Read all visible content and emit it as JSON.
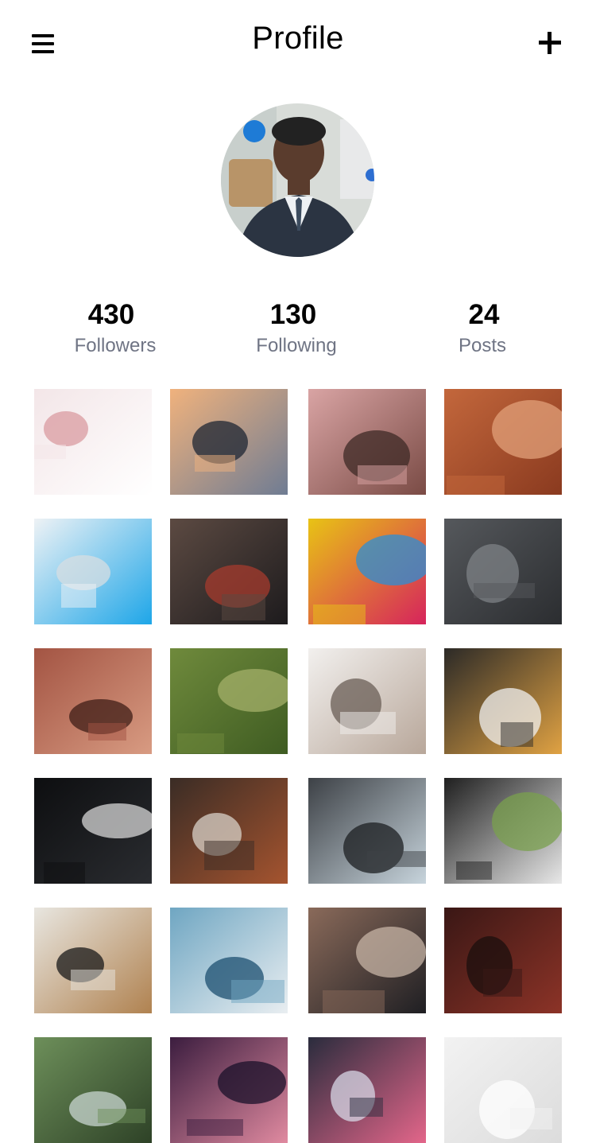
{
  "header": {
    "title": "Profile",
    "menu_icon": "hamburger-menu-icon",
    "add_icon": "plus-icon"
  },
  "profile": {
    "avatar_icon": "profile-avatar",
    "stats": [
      {
        "value": "430",
        "label": "Followers"
      },
      {
        "value": "130",
        "label": "Following"
      },
      {
        "value": "24",
        "label": "Posts"
      }
    ]
  },
  "posts": [
    {
      "name": "post-desk-workspace",
      "colors": [
        "#f3e6e8",
        "#ffffff",
        "#d99ba0"
      ]
    },
    {
      "name": "post-bridge-silhouette",
      "colors": [
        "#f0b27d",
        "#6f7c93",
        "#1e2633"
      ]
    },
    {
      "name": "post-pink-skirt-boots",
      "colors": [
        "#d9a4a4",
        "#7a4b45",
        "#3d2a26"
      ]
    },
    {
      "name": "post-red-hair-braid",
      "colors": [
        "#c3673c",
        "#8a3a1f",
        "#e2a07a"
      ]
    },
    {
      "name": "post-pool-room",
      "colors": [
        "#eef2f5",
        "#1ea6e8",
        "#d7dde2"
      ]
    },
    {
      "name": "post-woman-escalator",
      "colors": [
        "#5c4a42",
        "#1d1b1d",
        "#a63b2e"
      ]
    },
    {
      "name": "post-colorful-balls",
      "colors": [
        "#e8c315",
        "#d6245c",
        "#2b8fd6"
      ]
    },
    {
      "name": "post-black-pebbles",
      "colors": [
        "#55585c",
        "#2b2d30",
        "#7d8186"
      ]
    },
    {
      "name": "post-freckled-face",
      "colors": [
        "#a35443",
        "#d89b82",
        "#3f1e17"
      ]
    },
    {
      "name": "post-bird-on-branch",
      "colors": [
        "#6f8a3c",
        "#3f5c22",
        "#a4b06a"
      ]
    },
    {
      "name": "post-wooden-slats",
      "colors": [
        "#f2f0ee",
        "#b8a79a",
        "#6a5e56"
      ]
    },
    {
      "name": "post-toy-cars-lights",
      "colors": [
        "#2c2a27",
        "#e0a243",
        "#f0f0f0"
      ]
    },
    {
      "name": "post-light-painting",
      "colors": [
        "#0d0e10",
        "#2a2c30",
        "#d5d5d5"
      ]
    },
    {
      "name": "post-cafe-laptop",
      "colors": [
        "#3a2c25",
        "#a5542f",
        "#d8d2c8"
      ]
    },
    {
      "name": "post-ice-cave",
      "colors": [
        "#3d4146",
        "#c7d4dc",
        "#1c1f22"
      ]
    },
    {
      "name": "post-oval-window",
      "colors": [
        "#1f1f1f",
        "#e8e8e8",
        "#7aa04d"
      ]
    },
    {
      "name": "post-film-camera",
      "colors": [
        "#e8e6e0",
        "#b08250",
        "#1a1a1a"
      ]
    },
    {
      "name": "post-car-snow",
      "colors": [
        "#6fa6c2",
        "#e9eef1",
        "#1c4f70"
      ]
    },
    {
      "name": "post-man-street",
      "colors": [
        "#8a6a5a",
        "#1f1f23",
        "#c7b4a6"
      ]
    },
    {
      "name": "post-dark-forest",
      "colors": [
        "#3a1715",
        "#8c3327",
        "#1b0f0e"
      ]
    },
    {
      "name": "post-lake-forest",
      "colors": [
        "#6d8f5a",
        "#2e4227",
        "#c8d6d0"
      ]
    },
    {
      "name": "post-portrait-purple",
      "colors": [
        "#3b1d3f",
        "#e08aa0",
        "#1a102a"
      ]
    },
    {
      "name": "post-city-lights",
      "colors": [
        "#2a2c3d",
        "#e3668a",
        "#d7d7e6"
      ]
    },
    {
      "name": "post-white-sculpture",
      "colors": [
        "#f2f2f2",
        "#dcdcdc",
        "#ffffff"
      ]
    }
  ]
}
